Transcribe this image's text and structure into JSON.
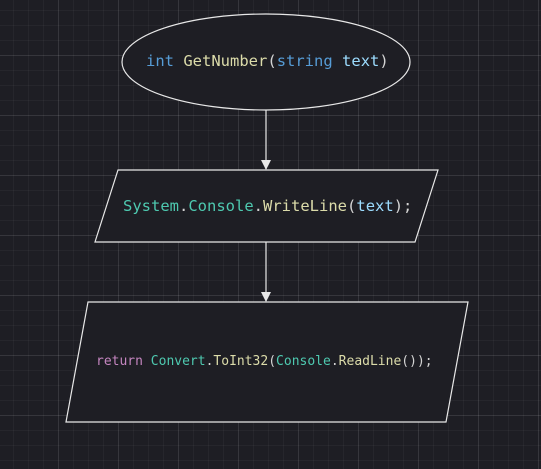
{
  "colors": {
    "background": "#1e1e24",
    "shape_stroke": "#e8e8e8",
    "keyword": "#569cd6",
    "control_keyword": "#c586c0",
    "class": "#4ec9b0",
    "method": "#dcdcaa",
    "parameter": "#9cdcfe",
    "punctuation": "#d4d4d4"
  },
  "flowchart": {
    "start": {
      "shape": "ellipse",
      "tokens": [
        {
          "text": "int",
          "kind": "keyword"
        },
        {
          "text": " ",
          "kind": "space"
        },
        {
          "text": "GetNumber",
          "kind": "method"
        },
        {
          "text": "(",
          "kind": "punct"
        },
        {
          "text": "string",
          "kind": "keyword"
        },
        {
          "text": " ",
          "kind": "space"
        },
        {
          "text": "text",
          "kind": "param"
        },
        {
          "text": ")",
          "kind": "punct"
        }
      ]
    },
    "step1": {
      "shape": "parallelogram",
      "tokens": [
        {
          "text": "System",
          "kind": "class"
        },
        {
          "text": ".",
          "kind": "punct"
        },
        {
          "text": "Console",
          "kind": "class"
        },
        {
          "text": ".",
          "kind": "punct"
        },
        {
          "text": "WriteLine",
          "kind": "method"
        },
        {
          "text": "(",
          "kind": "punct"
        },
        {
          "text": "text",
          "kind": "param"
        },
        {
          "text": ");",
          "kind": "punct"
        }
      ]
    },
    "step2": {
      "shape": "parallelogram",
      "tokens": [
        {
          "text": "return",
          "kind": "control"
        },
        {
          "text": " ",
          "kind": "space"
        },
        {
          "text": "Convert",
          "kind": "class"
        },
        {
          "text": ".",
          "kind": "punct"
        },
        {
          "text": "ToInt32",
          "kind": "method"
        },
        {
          "text": "(",
          "kind": "punct"
        },
        {
          "text": "Console",
          "kind": "class"
        },
        {
          "text": ".",
          "kind": "punct"
        },
        {
          "text": "ReadLine",
          "kind": "method"
        },
        {
          "text": "());",
          "kind": "punct"
        }
      ]
    },
    "edges": [
      {
        "from": "start",
        "to": "step1"
      },
      {
        "from": "step1",
        "to": "step2"
      }
    ]
  }
}
